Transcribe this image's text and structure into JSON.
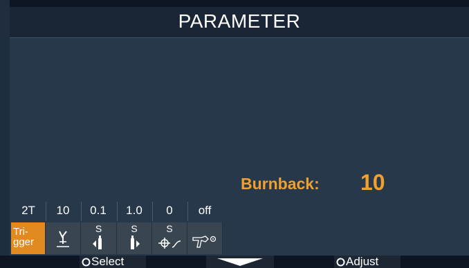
{
  "screen": {
    "title": "PARAMETER",
    "parameter": {
      "label": "Burnback:",
      "value": "10"
    }
  },
  "parameter_strip": {
    "values": [
      "2T",
      "10",
      "0.1",
      "1.0",
      "0",
      "off"
    ],
    "tiles": [
      {
        "name": "trigger",
        "label": "Tri-\ngger",
        "icon": "trigger",
        "active": true
      },
      {
        "name": "burnback",
        "label": "",
        "icon": "burnback-icon",
        "active": false
      },
      {
        "name": "pre-gas",
        "label": "S",
        "icon": "pre-gas-icon",
        "active": false
      },
      {
        "name": "post-gas",
        "label": "S",
        "icon": "post-gas-icon",
        "active": false
      },
      {
        "name": "wire-inch",
        "label": "S",
        "icon": "wire-feed-icon",
        "active": false
      },
      {
        "name": "torch",
        "label": "",
        "icon": "torch-icon",
        "active": false
      }
    ]
  },
  "softkeys": {
    "select": "Select",
    "adjust": "Adjust"
  },
  "colors": {
    "background": "#27384b",
    "accent": "#f0a02e",
    "active_tile": "#e08a1f",
    "tile": "#3a4552"
  }
}
